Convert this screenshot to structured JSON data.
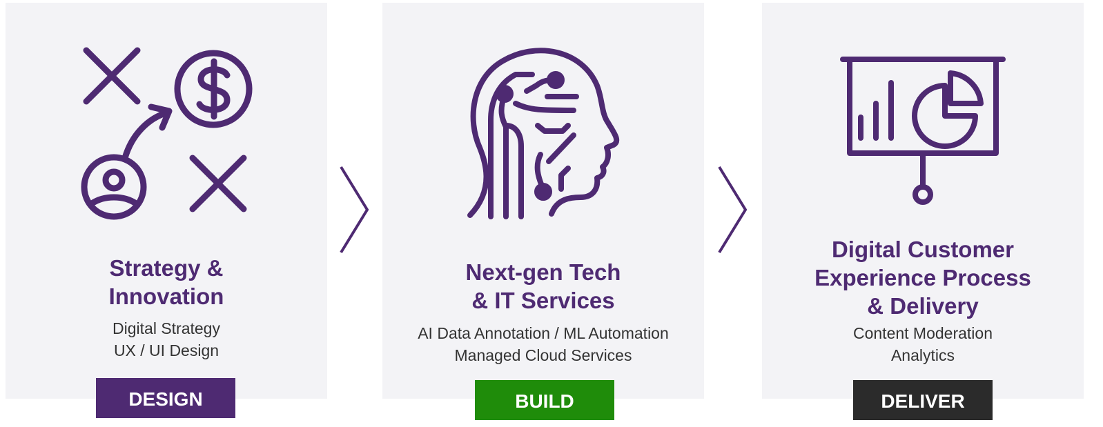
{
  "colors": {
    "accent": "#4e2a72",
    "card_bg": "#f3f3f6",
    "design_badge": "#4e2a72",
    "build_badge": "#1f8c0a",
    "deliver_badge": "#2b2b2b",
    "subtitle_text": "#333333"
  },
  "stages": [
    {
      "icon": "strategy-plan-icon",
      "title_lines": [
        "Strategy &",
        "Innovation"
      ],
      "items": [
        "Digital Strategy",
        "UX / UI Design"
      ],
      "badge": "DESIGN"
    },
    {
      "icon": "circuit-head-icon",
      "title_lines": [
        "Next-gen Tech",
        "& IT Services"
      ],
      "items": [
        "AI Data Annotation / ML Automation",
        "Managed Cloud Services"
      ],
      "badge": "BUILD"
    },
    {
      "icon": "presentation-chart-icon",
      "title_lines": [
        "Digital Customer",
        "Experience Process",
        "& Delivery"
      ],
      "items": [
        "Content Moderation",
        "Analytics"
      ],
      "badge": "DELIVER"
    }
  ],
  "connectors": [
    "chevron-right-icon",
    "chevron-right-icon"
  ]
}
